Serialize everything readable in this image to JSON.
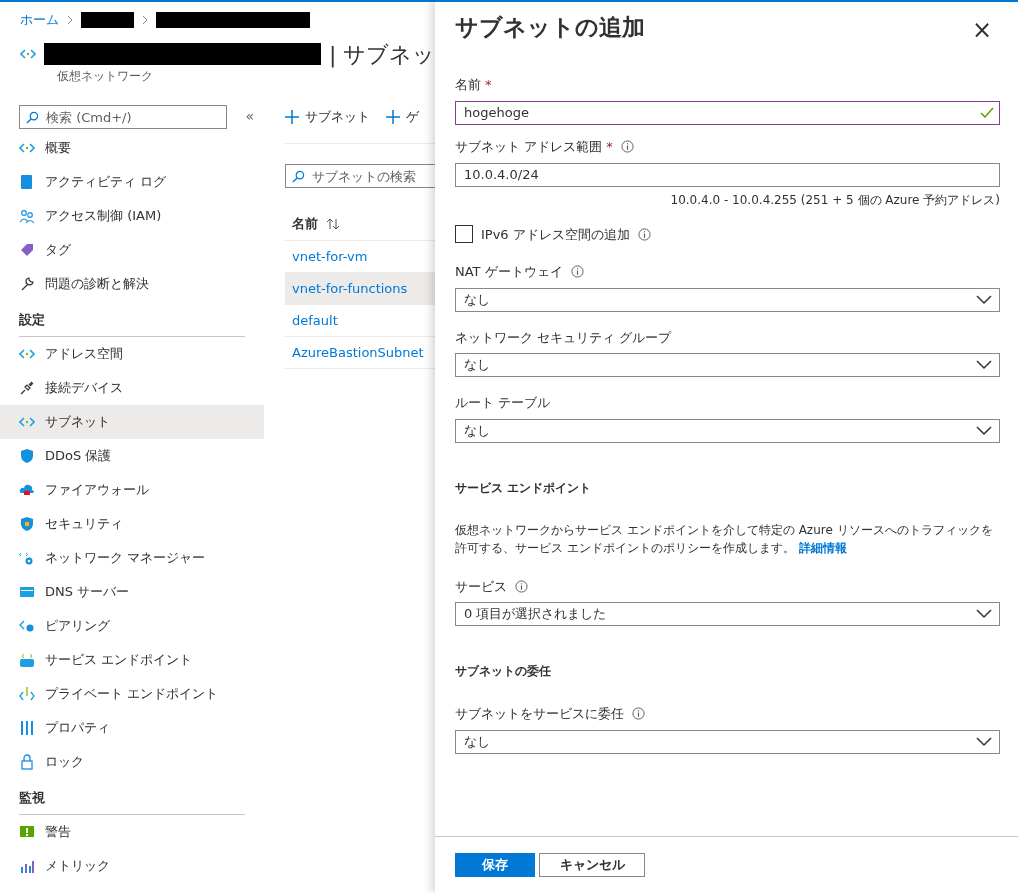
{
  "breadcrumb": [
    {
      "label": "ホーム",
      "kind": "link"
    },
    {
      "kind": "redacted"
    },
    {
      "kind": "redacted"
    }
  ],
  "resource": {
    "title_suffix": "| サブネッ",
    "subtitle": "仮想ネットワーク"
  },
  "sidebar": {
    "search": {
      "placeholder": "検索 (Cmd+/)"
    },
    "collapse": "«",
    "groups": [
      {
        "items": [
          {
            "label": "概要",
            "selected": false
          },
          {
            "label": "アクティビティ ログ",
            "selected": false
          },
          {
            "label": "アクセス制御 (IAM)",
            "selected": false
          },
          {
            "label": "タグ",
            "selected": false
          },
          {
            "label": "問題の診断と解決",
            "selected": false
          }
        ]
      },
      {
        "heading": "設定",
        "items": [
          {
            "label": "アドレス空間",
            "selected": false
          },
          {
            "label": "接続デバイス",
            "selected": false
          },
          {
            "label": "サブネット",
            "selected": true
          },
          {
            "label": "DDoS 保護",
            "selected": false
          },
          {
            "label": "ファイアウォール",
            "selected": false
          },
          {
            "label": "セキュリティ",
            "selected": false
          },
          {
            "label": "ネットワーク マネージャー",
            "selected": false
          },
          {
            "label": "DNS サーバー",
            "selected": false
          },
          {
            "label": "ピアリング",
            "selected": false
          },
          {
            "label": "サービス エンドポイント",
            "selected": false
          },
          {
            "label": "プライベート エンドポイント",
            "selected": false
          },
          {
            "label": "プロパティ",
            "selected": false
          },
          {
            "label": "ロック",
            "selected": false
          }
        ]
      },
      {
        "heading": "監視",
        "items": [
          {
            "label": "警告",
            "selected": false
          },
          {
            "label": "メトリック",
            "selected": false
          }
        ]
      }
    ]
  },
  "toolbar": [
    "サブネット",
    "ゲ"
  ],
  "table": {
    "search": {
      "placeholder": "サブネットの検索"
    },
    "columns": [
      "名前"
    ],
    "rows": [
      {
        "name": "vnet-for-vm",
        "selected": false
      },
      {
        "name": "vnet-for-functions",
        "selected": true
      },
      {
        "name": "default",
        "selected": false
      },
      {
        "name": "AzureBastionSubnet",
        "selected": false
      }
    ]
  },
  "panel": {
    "title": "サブネットの追加",
    "close": "×",
    "fields": [
      {
        "kind": "input",
        "label": "名前",
        "required_mark": "*",
        "value": "hogehoge",
        "valid": true
      },
      {
        "kind": "input",
        "label": "サブネット アドレス範囲",
        "required_mark": "*",
        "info": true,
        "value": "10.0.4.0/24",
        "valid": false,
        "hint": "10.0.4.0 - 10.0.4.255 (251 + 5 個の Azure 予約アドレス)"
      },
      {
        "kind": "checkbox",
        "label": "IPv6 アドレス空間の追加",
        "info": true,
        "checked": false
      },
      {
        "kind": "select",
        "label": "NAT ゲートウェイ",
        "info": true,
        "value": "なし"
      },
      {
        "kind": "select",
        "label": "ネットワーク セキュリティ グループ",
        "value": "なし"
      },
      {
        "kind": "select",
        "label": "ルート テーブル",
        "value": "なし"
      },
      {
        "kind": "heading",
        "label": "サービス エンドポイント"
      },
      {
        "kind": "paragraph",
        "text": "仮想ネットワークからサービス エンドポイントを介して特定の Azure リソースへのトラフィックを許可する、サービス エンドポイントのポリシーを作成します。",
        "link": "詳細情報"
      },
      {
        "kind": "select",
        "label": "サービス",
        "info": true,
        "value": "0 項目が選択されました"
      },
      {
        "kind": "heading",
        "label": "サブネットの委任"
      },
      {
        "kind": "select",
        "label": "サブネットをサービスに委任",
        "info": true,
        "value": "なし"
      }
    ],
    "buttons": [
      {
        "label": "保存",
        "kind": "primary"
      },
      {
        "label": "キャンセル",
        "kind": "secondary"
      }
    ]
  }
}
